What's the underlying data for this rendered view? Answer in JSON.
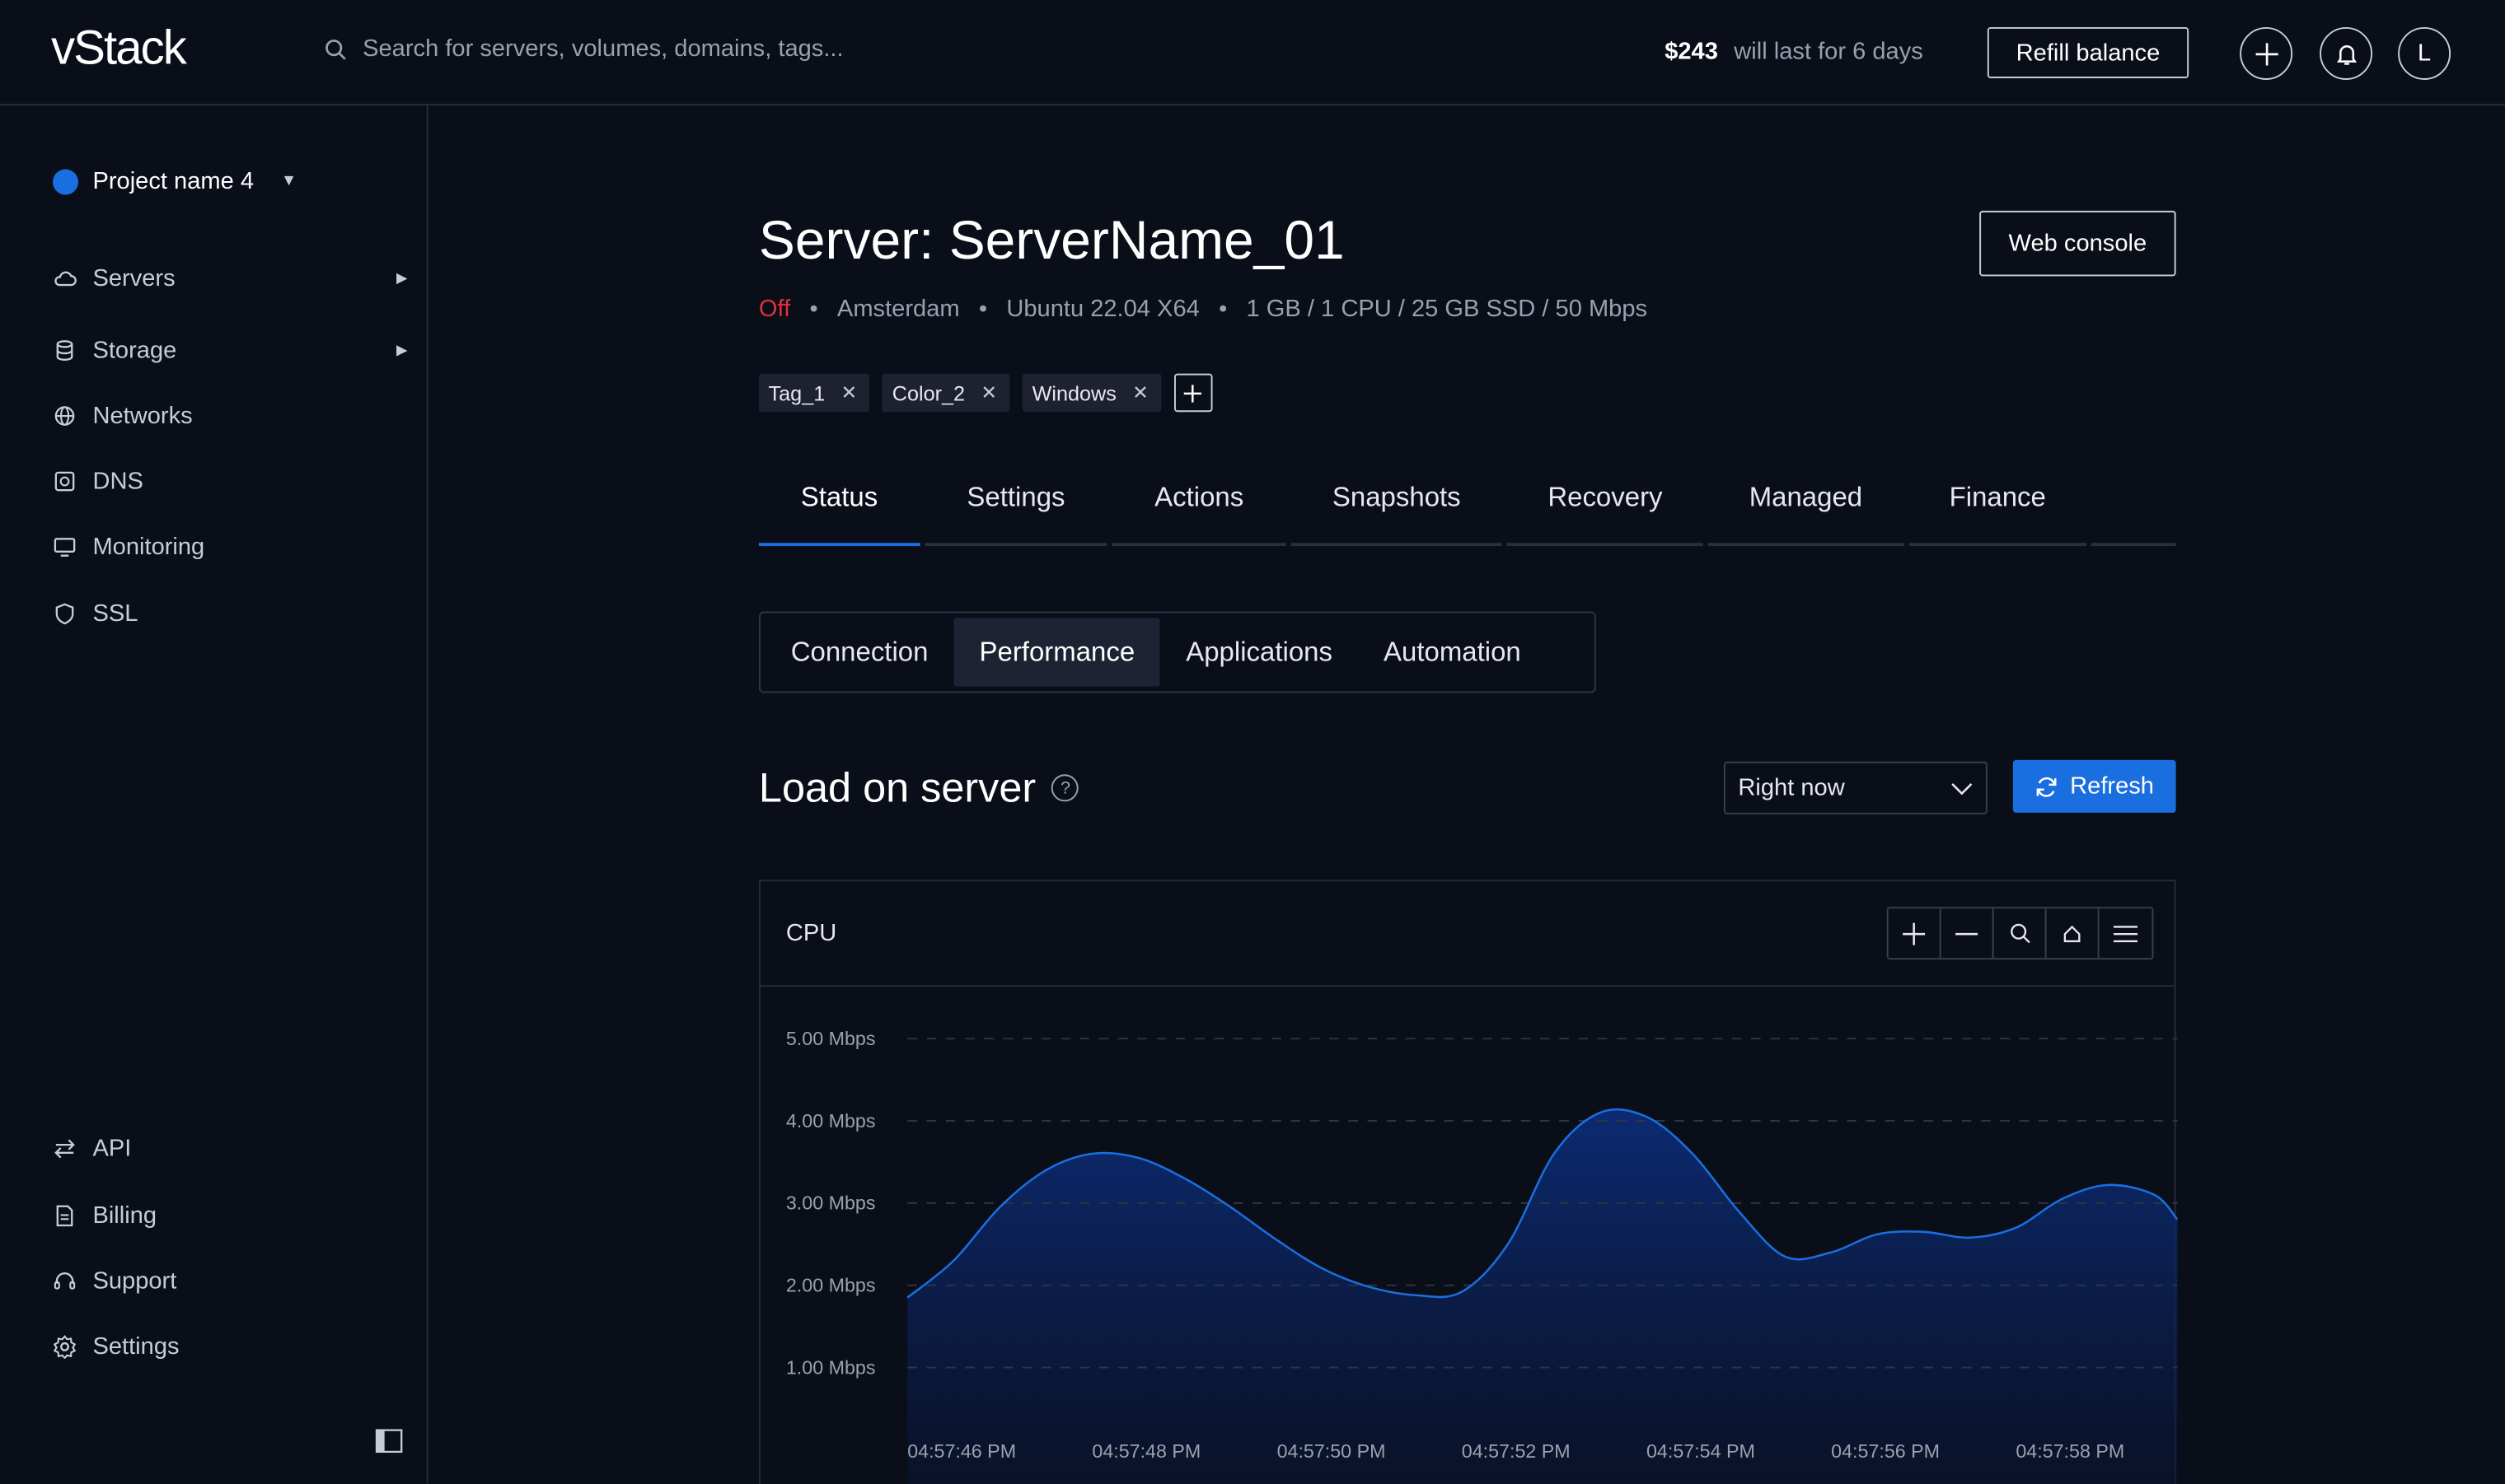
{
  "app": {
    "logo": "vStack",
    "search_placeholder": "Search for servers, volumes, domains, tags...",
    "balance_amount": "$243",
    "balance_note": "will last for 6 days",
    "refill_label": "Refill balance",
    "avatar_initial": "L"
  },
  "sidebar": {
    "project_name": "Project name 4",
    "items": [
      {
        "label": "Servers",
        "icon": "cloud-icon",
        "has_arrow": true
      },
      {
        "label": "Storage",
        "icon": "database-icon",
        "has_arrow": true
      },
      {
        "label": "Networks",
        "icon": "globe-icon",
        "has_arrow": false
      },
      {
        "label": "DNS",
        "icon": "dns-icon",
        "has_arrow": false
      },
      {
        "label": "Monitoring",
        "icon": "monitor-icon",
        "has_arrow": false
      },
      {
        "label": "SSL",
        "icon": "shield-icon",
        "has_arrow": false
      }
    ],
    "bottom_items": [
      {
        "label": "API",
        "icon": "arrows-icon"
      },
      {
        "label": "Billing",
        "icon": "document-icon"
      },
      {
        "label": "Support",
        "icon": "headset-icon"
      },
      {
        "label": "Settings",
        "icon": "gear-icon"
      }
    ]
  },
  "server": {
    "title": "Server: ServerName_01",
    "web_console_label": "Web console",
    "status": "Off",
    "location": "Amsterdam",
    "os": "Ubuntu 22.04 X64",
    "specs": "1 GB / 1 CPU / 25 GB SSD / 50 Mbps",
    "tags": [
      "Tag_1",
      "Color_2",
      "Windows"
    ]
  },
  "tabs": [
    "Status",
    "Settings",
    "Actions",
    "Snapshots",
    "Recovery",
    "Managed",
    "Finance"
  ],
  "active_tab": "Status",
  "subtabs": [
    "Connection",
    "Performance",
    "Applications",
    "Automation"
  ],
  "active_subtab": "Performance",
  "load": {
    "title": "Load on server",
    "range_value": "Right now",
    "refresh_label": "Refresh"
  },
  "colors": {
    "accent": "#1a6fe0",
    "status_off": "#e0303c",
    "background": "#0a0e19"
  },
  "chart_data": {
    "type": "area",
    "title": "CPU",
    "xlabel": "",
    "ylabel": "",
    "y_ticks": [
      "5.00 Mbps",
      "4.00 Mbps",
      "3.00 Mbps",
      "2.00 Mbps",
      "1.00 Mbps"
    ],
    "ylim": [
      0,
      5
    ],
    "x_ticks": [
      "04:57:46 PM",
      "04:57:48 PM",
      "04:57:50 PM",
      "04:57:52 PM",
      "04:57:54 PM",
      "04:57:56 PM",
      "04:57:58 PM"
    ],
    "series": [
      {
        "x": [
          0,
          0.5,
          1,
          1.5,
          2,
          2.5,
          3,
          3.5,
          4,
          4.5,
          5,
          5.5,
          6,
          6.5,
          7,
          7.5,
          8,
          8.5,
          9,
          9.5,
          10,
          10.5,
          11,
          11.5,
          12,
          12.5,
          13,
          13.5,
          13.75
        ],
        "values": [
          1.85,
          2.3,
          2.95,
          3.4,
          3.6,
          3.55,
          3.3,
          2.95,
          2.55,
          2.2,
          1.98,
          1.88,
          1.92,
          2.5,
          3.6,
          4.1,
          4.05,
          3.6,
          2.9,
          2.35,
          2.4,
          2.62,
          2.65,
          2.58,
          2.7,
          3.05,
          3.22,
          3.1,
          2.8
        ]
      }
    ],
    "grid": true
  }
}
